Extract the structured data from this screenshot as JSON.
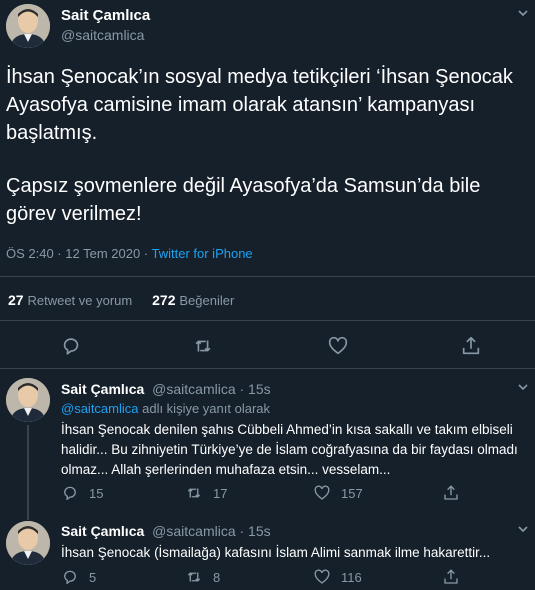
{
  "main_tweet": {
    "author_name": "Sait Çamlıca",
    "handle": "@saitcamlica",
    "text_p1": "İhsan Şenocak’ın sosyal medya tetikçileri ‘İhsan Şenocak Ayasofya camisine imam olarak atansın’ kampanyası başlatmış.",
    "text_p2": "Çapsız şovmenlere değil Ayasofya’da Samsun’da bile görev verilmez!",
    "time": "ÖS 2:40 · 12 Tem 2020 · ",
    "source": "Twitter for iPhone",
    "retweets_count": "27",
    "retweets_label": "Retweet ve yorum",
    "likes_count": "272",
    "likes_label": "Beğeniler"
  },
  "replies": [
    {
      "author_name": "Sait Çamlıca",
      "handle_time": "@saitcamlica · 15s",
      "reply_to_handle": "@saitcamlica",
      "reply_to_suffix": " adlı kişiye yanıt olarak",
      "text": "İhsan Şenocak denilen şahıs Cübbeli Ahmed’in kısa sakallı ve takım elbiseli halidir... Bu zihniyetin Türkiye’ye de İslam coğrafyasına da bir faydası olmadı olmaz... Allah şerlerinden muhafaza etsin... vesselam...",
      "replies": "15",
      "retweets": "17",
      "likes": "157"
    },
    {
      "author_name": "Sait Çamlıca",
      "handle_time": "@saitcamlica · 15s",
      "text": "İhsan Şenocak (İsmailağa) kafasını İslam Alimi sanmak ilme hakarettir...",
      "replies": "5",
      "retweets": "8",
      "likes": "116"
    }
  ],
  "icons": {
    "more": "chevron-down-icon",
    "reply": "reply-icon",
    "retweet": "retweet-icon",
    "like": "heart-icon",
    "share": "share-icon"
  },
  "colors": {
    "background": "#15202b",
    "accent": "#1da1f2",
    "muted": "#8899a6",
    "divider": "#38444d"
  }
}
